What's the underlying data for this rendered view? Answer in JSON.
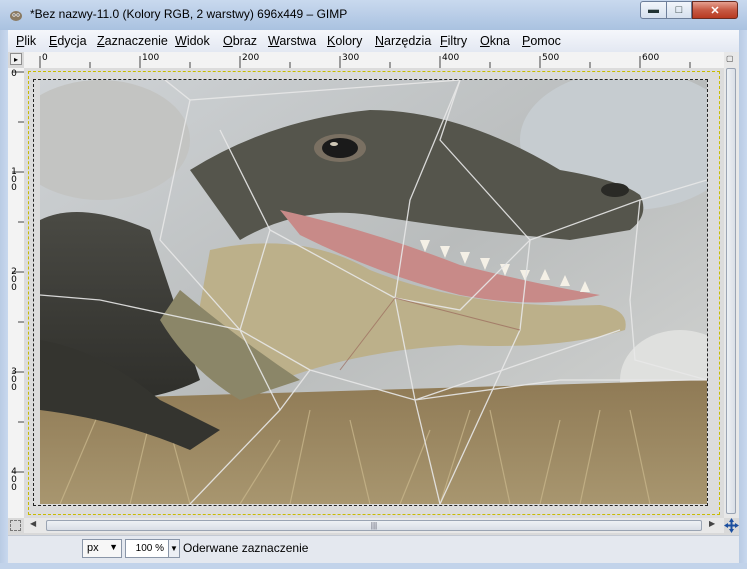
{
  "window": {
    "title": "*Bez nazwy-11.0 (Kolory RGB, 2 warstwy) 696x449 – GIMP",
    "app_icon": "gimp-icon",
    "controls": {
      "minimize": "minimize-icon",
      "maximize": "maximize-icon",
      "close": "close-icon"
    }
  },
  "menu": {
    "items": [
      "Plik",
      "Edycja",
      "Zaznaczenie",
      "Widok",
      "Obraz",
      "Warstwa",
      "Kolory",
      "Narzędzia",
      "Filtry",
      "Okna",
      "Pomoc"
    ]
  },
  "rulers": {
    "horizontal": [
      "0",
      "100",
      "200",
      "300",
      "400",
      "500",
      "600"
    ],
    "vertical": [
      "0",
      "100",
      "200",
      "300",
      "400"
    ]
  },
  "canvas": {
    "image_subject": "alligator photo with open jaw, overlaid with lines of cracked/shattered glass pattern"
  },
  "statusbar": {
    "unit": "px",
    "zoom": "100 %",
    "message": "Oderwane zaznaczenie"
  },
  "colors": {
    "title_bar": "#b6cbe6",
    "close_button": "#c75a44",
    "canvas_boundary": "#c8bb00"
  }
}
